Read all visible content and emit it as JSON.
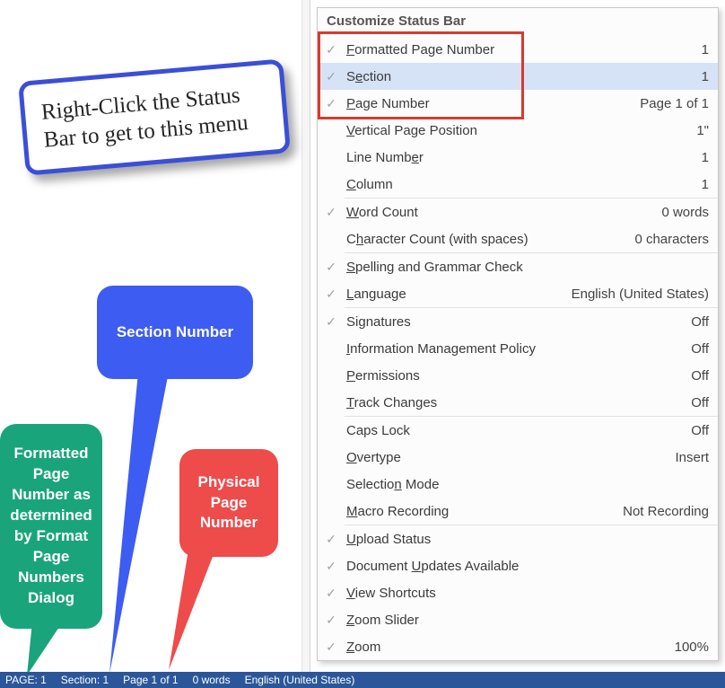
{
  "instruction": "Right-Click the Status Bar to get to this menu",
  "callouts": {
    "blue": "Section Number",
    "green": "Formatted Page Number as determined by Format Page Numbers Dialog",
    "red": "Physical Page Number"
  },
  "menu": {
    "title": "Customize Status Bar",
    "groups": [
      [
        {
          "checked": true,
          "label": "<u>F</u>ormatted Page Number",
          "value": "1"
        },
        {
          "checked": true,
          "label": "S<u>e</u>ction",
          "value": "1",
          "hover": true
        },
        {
          "checked": true,
          "label": "<u>P</u>age Number",
          "value": "Page 1 of 1"
        },
        {
          "checked": false,
          "label": "<u>V</u>ertical Page Position",
          "value": "1\""
        },
        {
          "checked": false,
          "label": "Line Numb<u>e</u>r",
          "value": "1"
        },
        {
          "checked": false,
          "label": "<u>C</u>olumn",
          "value": "1"
        }
      ],
      [
        {
          "checked": true,
          "label": "<u>W</u>ord Count",
          "value": "0 words"
        },
        {
          "checked": false,
          "label": "C<u>h</u>aracter Count (with spaces)",
          "value": "0 characters"
        }
      ],
      [
        {
          "checked": true,
          "label": "<u>S</u>pelling and Grammar Check",
          "value": ""
        },
        {
          "checked": true,
          "label": "<u>L</u>anguage",
          "value": "English (United States)"
        }
      ],
      [
        {
          "checked": true,
          "label": "Si<u>g</u>natures",
          "value": "Off"
        },
        {
          "checked": false,
          "label": "<u>I</u>nformation Management Policy",
          "value": "Off"
        },
        {
          "checked": false,
          "label": "<u>P</u>ermissions",
          "value": "Off"
        },
        {
          "checked": false,
          "label": "<u>T</u>rack Changes",
          "value": "Off"
        }
      ],
      [
        {
          "checked": false,
          "label": "Caps Lock",
          "value": "Off"
        },
        {
          "checked": false,
          "label": "<u>O</u>vertype",
          "value": "Insert"
        },
        {
          "checked": false,
          "label": "Selectio<u>n</u> Mode",
          "value": ""
        },
        {
          "checked": false,
          "label": "<u>M</u>acro Recording",
          "value": "Not Recording"
        }
      ],
      [
        {
          "checked": true,
          "label": "<u>U</u>pload Status",
          "value": ""
        },
        {
          "checked": true,
          "label": "Document <u>U</u>pdates Available",
          "value": ""
        },
        {
          "checked": true,
          "label": "<u>V</u>iew Shortcuts",
          "value": ""
        },
        {
          "checked": true,
          "label": "<u>Z</u>oom Slider",
          "value": ""
        },
        {
          "checked": true,
          "label": "<u>Z</u>oom",
          "value": "100%"
        }
      ]
    ]
  },
  "statusbar": {
    "page": "PAGE: 1",
    "section": "Section: 1",
    "pageof": "Page 1 of 1",
    "words": "0 words",
    "lang": "English (United States)"
  }
}
